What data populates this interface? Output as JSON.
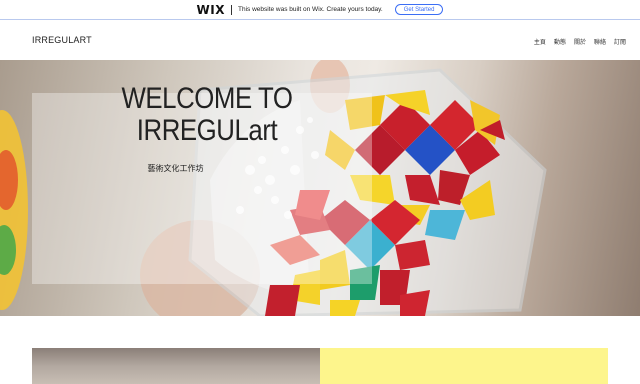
{
  "wix_banner": {
    "logo": "WIX",
    "message": "This website was built on Wix. Create yours today.",
    "cta_label": "Get Started"
  },
  "header": {
    "site_title": "IRREGULART",
    "nav": [
      {
        "label": "主頁"
      },
      {
        "label": "動態"
      },
      {
        "label": "關於"
      },
      {
        "label": "聯絡"
      },
      {
        "label": "訂閱"
      }
    ]
  },
  "hero": {
    "title_line1": "WELCOME TO",
    "title_line2": "IRREGULart",
    "subtitle": "藝術文化工作坊"
  },
  "colors": {
    "accent": "#3b6ef5",
    "yellow_block": "#fdf58c"
  }
}
